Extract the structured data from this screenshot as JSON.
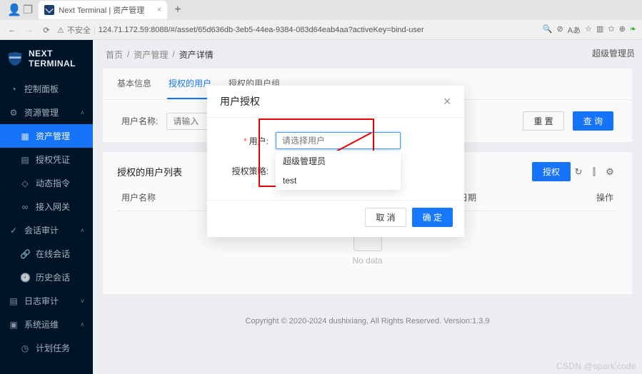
{
  "browser": {
    "tab_title": "Next Terminal | 资产管理",
    "insecure_label": "不安全",
    "url": "124.71.172.59:8088/#/asset/65d636db-3eb5-44ea-9384-083d64eab4aa?activeKey=bind-user"
  },
  "brand": {
    "line1": "NEXT",
    "line2": "TERMINAL"
  },
  "sidebar": {
    "dashboard": "控制面板",
    "resource": "资源管理",
    "asset": "资产管理",
    "credential": "授权凭证",
    "dynamic": "动态指令",
    "gateway": "接入网关",
    "session": "会话审计",
    "online": "在线会话",
    "history": "历史会话",
    "log": "日志审计",
    "ops": "系统运维",
    "schedule": "计划任务"
  },
  "breadcrumb": {
    "home": "首页",
    "asset": "资产管理",
    "detail": "资产详情"
  },
  "top_user": "超级管理员",
  "tabs": {
    "basic": "基本信息",
    "users": "授权的用户",
    "groups": "授权的用户组"
  },
  "filter": {
    "label": "用户名称:",
    "placeholder": "请输入",
    "reset": "重 置",
    "search": "查 询"
  },
  "list": {
    "title": "授权的用户列表",
    "col_name": "用户名称",
    "col_date": "授权日期",
    "col_op": "操作",
    "empty": "No data",
    "authorize": "授权"
  },
  "modal": {
    "title": "用户授权",
    "user_label": "用户:",
    "user_placeholder": "请选择用户",
    "policy_label": "授权策略:",
    "options": [
      "超级管理员",
      "test"
    ],
    "cancel": "取 消",
    "ok": "确 定"
  },
  "footer": "Copyright © 2020-2024 dushixiang, All Rights Reserved. Version:1.3.9",
  "watermark": "CSDN @spark'code"
}
